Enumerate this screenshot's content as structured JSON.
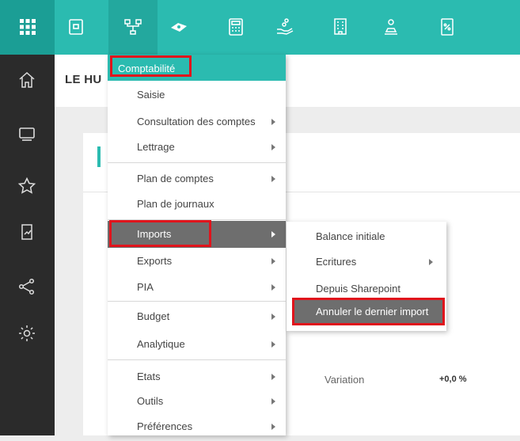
{
  "topbar": {
    "icons": [
      "apps-grid-icon",
      "ledger-icon",
      "org-chart-icon",
      "money-icon",
      "calculator-icon",
      "hand-coins-icon",
      "building-icon",
      "user-stamp-icon",
      "percent-doc-icon"
    ],
    "colors": {
      "bar": "#2bbbb0",
      "grid_tile": "#1b9e95",
      "active_tile": "#23a89e"
    }
  },
  "sidebar": {
    "icons": [
      "home-icon",
      "monitor-icon",
      "star-icon",
      "chart-doc-icon",
      "share-icon",
      "gear-icon"
    ],
    "color": "#2b2b2b"
  },
  "page": {
    "title": "LE HU",
    "variation_label": "Variation",
    "variation_value": "+0,0 %"
  },
  "menu": {
    "title": "Comptabilité",
    "items": [
      {
        "label": "Saisie",
        "arrow": false
      },
      {
        "label": "Consultation des comptes",
        "arrow": true
      },
      {
        "label": "Lettrage",
        "arrow": true
      },
      {
        "label": "Plan de comptes",
        "arrow": true
      },
      {
        "label": "Plan de journaux",
        "arrow": false
      },
      {
        "label": "Imports",
        "arrow": true,
        "active": true
      },
      {
        "label": "Exports",
        "arrow": true
      },
      {
        "label": "PIA",
        "arrow": true
      },
      {
        "label": "Budget",
        "arrow": true
      },
      {
        "label": "Analytique",
        "arrow": true
      },
      {
        "label": "Etats",
        "arrow": true
      },
      {
        "label": "Outils",
        "arrow": true
      },
      {
        "label": "Préférences",
        "arrow": true
      }
    ]
  },
  "submenu": {
    "items": [
      {
        "label": "Balance initiale",
        "arrow": false
      },
      {
        "label": "Ecritures",
        "arrow": true
      },
      {
        "label": "Depuis Sharepoint",
        "arrow": false
      },
      {
        "label": "Annuler le dernier import",
        "arrow": false,
        "active": true
      }
    ]
  },
  "highlight_color": "#e0141c",
  "accent_color": "#2bbbb0"
}
